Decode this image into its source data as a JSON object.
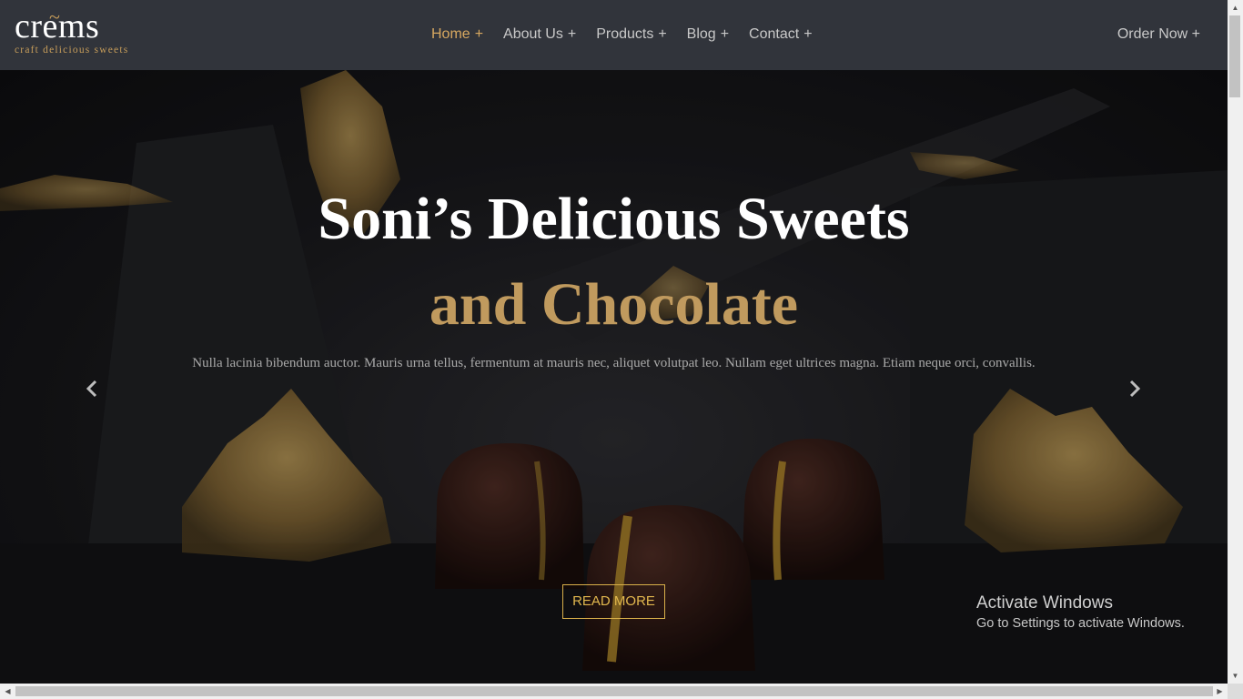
{
  "brand": {
    "logo_text": "crems",
    "tilde": "~",
    "tagline": "craft delicious sweets"
  },
  "nav": {
    "items": [
      {
        "label": "Home",
        "plus": "+",
        "active": true
      },
      {
        "label": "About Us",
        "plus": "+",
        "active": false
      },
      {
        "label": "Products",
        "plus": "+",
        "active": false
      },
      {
        "label": "Blog",
        "plus": "+",
        "active": false
      },
      {
        "label": "Contact",
        "plus": "+",
        "active": false
      }
    ],
    "order_now": "Order Now +"
  },
  "hero": {
    "title": "Soni’s Delicious Sweets",
    "subtitle": "and Chocolate",
    "description": "Nulla lacinia bibendum auctor. Mauris urna tellus, fermentum at mauris nec, aliquet volutpat leo. Nullam eget ultrices magna. Etiam neque orci, convallis.",
    "cta": "READ MORE",
    "prev_icon": "chevron-left-icon",
    "next_icon": "chevron-right-icon"
  },
  "watermark": {
    "title": "Activate Windows",
    "subtitle": "Go to Settings to activate Windows."
  },
  "colors": {
    "header_bg": "#31343b",
    "accent_gold": "#c09a5e",
    "cta_gold": "#e2b84e",
    "nav_active": "#d7a860"
  }
}
